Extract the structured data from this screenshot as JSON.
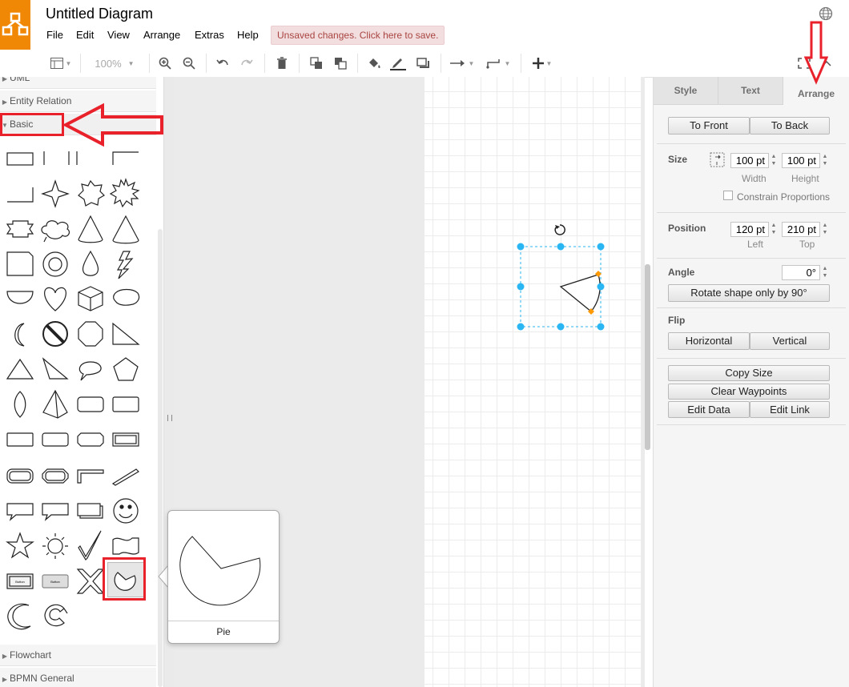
{
  "app": {
    "title": "Untitled Diagram",
    "unsaved_notice": "Unsaved changes. Click here to save."
  },
  "menu": [
    "File",
    "Edit",
    "View",
    "Arrange",
    "Extras",
    "Help"
  ],
  "toolbar": {
    "zoom": "100%"
  },
  "sidebar": {
    "sections_top": [
      "UML",
      "Entity Relation",
      "Basic"
    ],
    "sections_bottom": [
      "Flowchart",
      "BPMN General"
    ],
    "highlighted_shape": "Pie"
  },
  "tooltip": {
    "label": "Pie"
  },
  "panel": {
    "tabs": [
      "Style",
      "Text",
      "Arrange"
    ],
    "active_tab": "Arrange",
    "to_front": "To Front",
    "to_back": "To Back",
    "size_label": "Size",
    "width_value": "100 pt",
    "height_value": "100 pt",
    "width_label": "Width",
    "height_label": "Height",
    "constrain": "Constrain Proportions",
    "position_label": "Position",
    "left_value": "120 pt",
    "top_value": "210 pt",
    "left_label": "Left",
    "top_label": "Top",
    "angle_label": "Angle",
    "angle_value": "0°",
    "rotate_btn": "Rotate shape only by 90°",
    "flip_label": "Flip",
    "horizontal": "Horizontal",
    "vertical": "Vertical",
    "copy_size": "Copy Size",
    "clear_waypoints": "Clear Waypoints",
    "edit_data": "Edit Data",
    "edit_link": "Edit Link"
  },
  "colors": {
    "brand": "#f08705",
    "selection": "#29b6f2",
    "handle": "#ff9900",
    "annotation": "#e8212b"
  }
}
